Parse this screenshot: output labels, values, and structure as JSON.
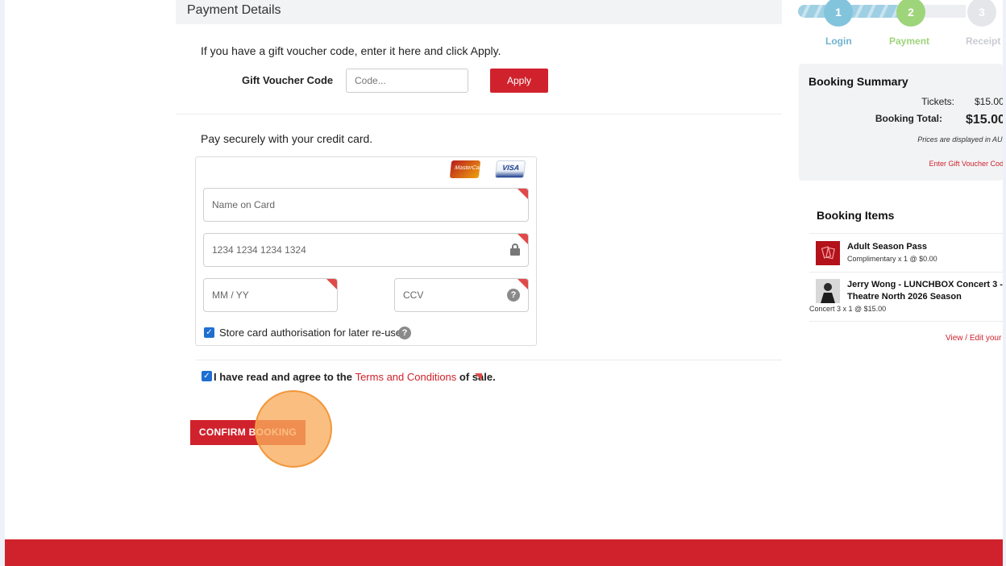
{
  "payment": {
    "section_title": "Payment Details",
    "voucher_prompt": "If you have a gift voucher code, enter it here and click Apply.",
    "voucher_label": "Gift Voucher Code",
    "voucher_placeholder": "Code...",
    "apply_label": "Apply",
    "pay_prompt": "Pay securely with your credit card.",
    "card_logos": [
      "mastercard-icon",
      "visa-icon"
    ],
    "name_placeholder": "Name on Card",
    "number_placeholder": "1234 1234 1234 1324",
    "expiry_placeholder": "MM / YY",
    "ccv_placeholder": "CCV",
    "store_card_label": "Store card authorisation for later re-use",
    "store_card_checked": true
  },
  "terms": {
    "checked": true,
    "prefix": "I have read and agree to the ",
    "link": "Terms and Conditions",
    "suffix": " of sale."
  },
  "confirm_label": "CONFIRM BOOKING",
  "stepper": {
    "steps": [
      {
        "number": "1",
        "label": "Login",
        "color": "#82c4dc"
      },
      {
        "number": "2",
        "label": "Payment",
        "color": "#9ed47a"
      },
      {
        "number": "3",
        "label": "Receipt",
        "color": "#d9dbe0"
      }
    ]
  },
  "summary": {
    "title": "Booking Summary",
    "tickets_label": "Tickets:",
    "tickets_value": "$15.00",
    "total_label": "Booking Total:",
    "total_value": "$15.00",
    "currency_note": "Prices are displayed in AUD",
    "voucher_link": "Enter Gift Voucher Code"
  },
  "booking_items": {
    "title": "Booking Items",
    "items": [
      {
        "name": "Adult Season Pass",
        "detail": "Complimentary x 1 @ $0.00"
      },
      {
        "name_line1": "Jerry Wong - LUNCHBOX Concert 3 -",
        "name_line2": "Theatre North 2026 Season",
        "detail": "Concert 3 x 1 @ $15.00"
      }
    ],
    "view_edit_link": "View / Edit your"
  },
  "colors": {
    "brand_red": "#d0222c",
    "checkbox_blue": "#1f6fd1",
    "click_highlight": "#f8ac5c"
  }
}
